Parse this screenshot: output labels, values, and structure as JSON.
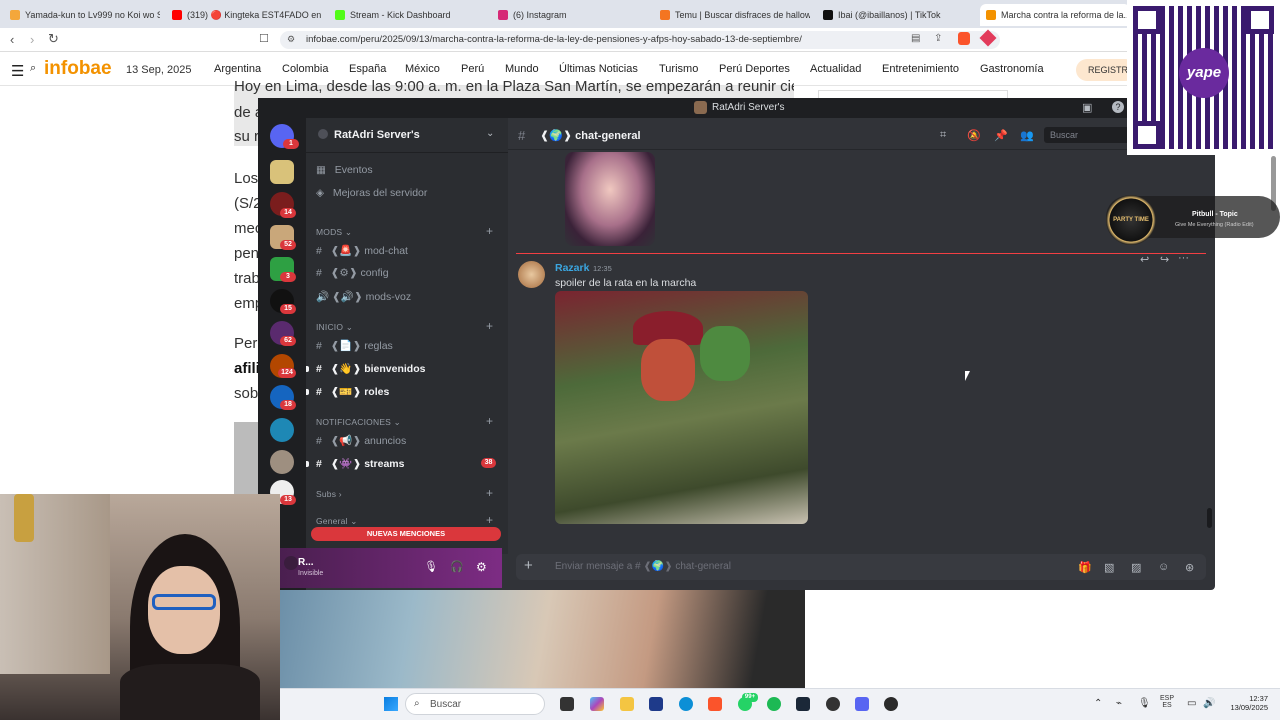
{
  "browser": {
    "tabs": [
      {
        "title": "Yamada-kun to Lv999 no Koi wo Su...",
        "color": "#f4a73b"
      },
      {
        "title": "(319) 🔴 Kingteka EST4FADO en Est...",
        "color": "#ff0000"
      },
      {
        "title": "Stream - Kick Dashboard",
        "color": "#53fc18"
      },
      {
        "title": "(6) Instagram",
        "color": "#d62976"
      },
      {
        "title": "Temu | Buscar disfraces de hallowee...",
        "color": "#f47521"
      },
      {
        "title": "Ibai (@ibaillanos) | TikTok",
        "color": "#111111"
      },
      {
        "title": "Marcha contra la reforma de la...",
        "color": "#f39200"
      }
    ],
    "url": "infobae.com/peru/2025/09/13/marcha-contra-la-reforma-de-la-ley-de-pensiones-y-afps-hoy-sabado-13-de-septiembre/"
  },
  "site": {
    "logo": "infobae",
    "date": "13 Sep, 2025",
    "nav": [
      "Argentina",
      "Colombia",
      "España",
      "México",
      "Perú",
      "Mundo",
      "Últimas Noticias",
      "Turismo",
      "Perú Deportes",
      "Actualidad",
      "Entretenimiento",
      "Gastronomía"
    ],
    "register": "REGISTRA",
    "accent": "#f39200",
    "article_lines": [
      "Hoy en Lima, desde las 9:00 a. m. en la Plaza San Martín, se empezarán a reunir cientos",
      "de a",
      "su r",
      "Los",
      "(S/2",
      "mec",
      "pen",
      "trab",
      "emp",
      "Per",
      "afili",
      "sob"
    ]
  },
  "discord": {
    "window_title": "RatAdri Server's",
    "server_name": "RatAdri Server's",
    "guild_badges": [
      "1",
      "14",
      "52",
      "3",
      "15",
      "62",
      "124",
      "18",
      "13"
    ],
    "server_menu": [
      {
        "icon": "calendar-icon",
        "label": "Eventos"
      },
      {
        "icon": "boost-icon",
        "label": "Mejoras del servidor"
      }
    ],
    "categories": [
      {
        "name": "MODS",
        "channels": [
          {
            "prefix": "#",
            "label": "❰🚨❱ mod-chat",
            "bold": false
          },
          {
            "prefix": "#",
            "label": "❰⚙❱ config",
            "bold": false
          },
          {
            "prefix": "🔊",
            "label": "❰🔊❱ mods-voz",
            "bold": false
          }
        ]
      },
      {
        "name": "INICIO",
        "channels": [
          {
            "prefix": "#",
            "label": "❰📄❱ reglas",
            "bold": false
          },
          {
            "prefix": "#",
            "label": "❰👋❱ bienvenidos",
            "bold": true
          },
          {
            "prefix": "#",
            "label": "❰🎫❱ roles",
            "bold": true
          }
        ]
      },
      {
        "name": "NOTIFICACIONES",
        "channels": [
          {
            "prefix": "#",
            "label": "❰📢❱ anuncios",
            "bold": false
          },
          {
            "prefix": "#",
            "label": "❰👾❱ streams",
            "bold": true,
            "badge": "38"
          }
        ]
      },
      {
        "name": "Subs",
        "channels": []
      },
      {
        "name": "General",
        "channels": []
      }
    ],
    "mentions_banner": "NUEVAS MENCIONES",
    "user": {
      "name": "R...",
      "status": "Invisible"
    },
    "channel_header": "❰🌍❱ chat-general",
    "search_placeholder": "Buscar",
    "message": {
      "author": "Razark",
      "time": "12:35",
      "text": "spoiler de la rata en la marcha"
    },
    "composer_placeholder": "Enviar mensaje a # ❰🌍❱ chat-general"
  },
  "spotify": {
    "title": "Pitbull - Topic",
    "subtitle": "Give Me Everything (Radio Edit)",
    "art_text": "PARTY TIME"
  },
  "qr": {
    "brand": "yape"
  },
  "taskbar": {
    "search": "Buscar",
    "badges": {
      "whatsapp": "99+"
    },
    "lang": "ESP",
    "region": "ES",
    "time": "12:37",
    "date": "13/09/2025"
  }
}
